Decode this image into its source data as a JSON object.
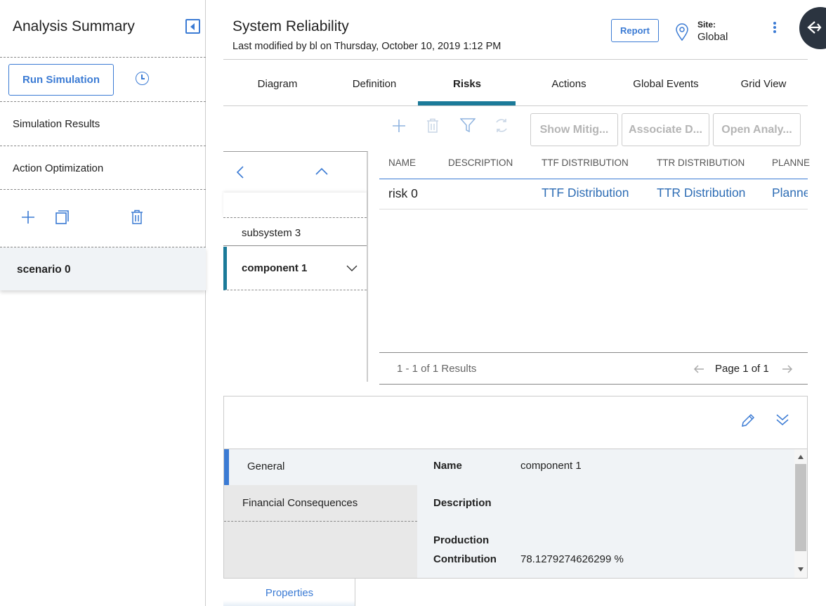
{
  "left": {
    "title": "Analysis Summary",
    "run_label": "Run Simulation",
    "items": [
      "Simulation Results",
      "Action Optimization"
    ],
    "scenario": "scenario 0"
  },
  "header": {
    "title": "System Reliability",
    "subtitle": "Last modified by bl on Thursday, October 10, 2019 1:12 PM",
    "report": "Report",
    "site_label": "Site:",
    "site_value": "Global"
  },
  "tabs": [
    "Diagram",
    "Definition",
    "Risks",
    "Actions",
    "Global Events",
    "Grid View"
  ],
  "toolbar": {
    "show_mitig": "Show Mitig...",
    "associate": "Associate D...",
    "open_analysis": "Open Analy..."
  },
  "tree": {
    "items": [
      "subsystem 3",
      "component 1"
    ]
  },
  "grid": {
    "headers": [
      "NAME",
      "DESCRIPTION",
      "TTF DISTRIBUTION",
      "TTR DISTRIBUTION",
      "PLANNE"
    ],
    "row": {
      "name": "risk 0",
      "description": "",
      "ttf": "TTF Distribution",
      "ttr": "TTR Distribution",
      "planned": "Planne"
    },
    "results": "1 - 1 of 1 Results",
    "page": "Page 1 of 1"
  },
  "details": {
    "sections": [
      "General",
      "Financial Consequences"
    ],
    "fields": {
      "name_label": "Name",
      "name_value": "component 1",
      "desc_label": "Description",
      "prod_label_1": "Production",
      "prod_label_2": "Contribution",
      "prod_value": "78.1279274626299 %"
    },
    "bottom_tab": "Properties"
  }
}
